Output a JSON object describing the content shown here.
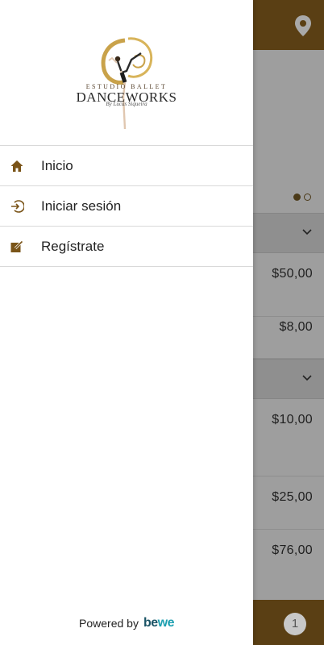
{
  "menu": {
    "items": [
      {
        "label": "Inicio",
        "icon": "home-icon"
      },
      {
        "label": "Iniciar sesión",
        "icon": "login-icon"
      },
      {
        "label": "Regístrate",
        "icon": "edit-icon"
      }
    ]
  },
  "logo": {
    "studio": "ESTUDIO BALLET",
    "name": "DANCEWORKS",
    "byline": "By Lucas Siqueira"
  },
  "footer": {
    "powered_text": "Powered by",
    "brand_b": "be",
    "brand_w": "we"
  },
  "background": {
    "prices": [
      "$50,00",
      "$8,00",
      "$10,00",
      "$25,00",
      "$76,00"
    ],
    "cart_count": "1"
  },
  "colors": {
    "brand_brown": "#5a3f14",
    "icon_brown": "#7a5418"
  }
}
